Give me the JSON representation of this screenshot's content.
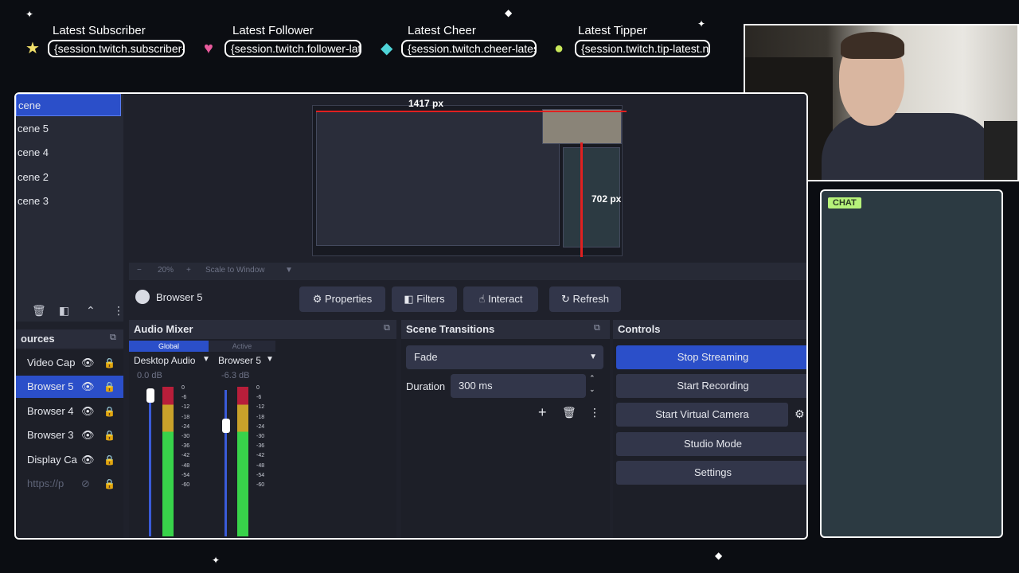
{
  "alerts": [
    {
      "title": "Latest Subscriber",
      "value": "{session.twitch.subscriber-latest.name}",
      "icon": "star-icon",
      "icon_color": "#f2e06a"
    },
    {
      "title": "Latest Follower",
      "value": "{session.twitch.follower-latest.name}",
      "icon": "heart-icon",
      "icon_color": "#e85a9c"
    },
    {
      "title": "Latest Cheer",
      "value": "{session.twitch.cheer-latest.name}",
      "icon": "gem-icon",
      "icon_color": "#4fd4d8"
    },
    {
      "title": "Latest Tipper",
      "value": "{session.twitch.tip-latest.name}",
      "icon": "coin-icon",
      "icon_color": "#c9e85a"
    }
  ],
  "chat": {
    "label": "CHAT"
  },
  "scenes": [
    {
      "label": "cene",
      "active": true
    },
    {
      "label": "cene 5",
      "active": false
    },
    {
      "label": "cene 4",
      "active": false
    },
    {
      "label": "cene 2",
      "active": false
    },
    {
      "label": "cene 3",
      "active": false
    }
  ],
  "preview": {
    "width_label": "1417 px",
    "height_label": "702 px"
  },
  "zoombar": {
    "minus": "−",
    "zoom": "20%",
    "plus": "+",
    "scale": "Scale to Window"
  },
  "source_toolbar": {
    "source_name": "Browser 5",
    "properties": "Properties",
    "filters": "Filters",
    "interact": "Interact",
    "refresh": "Refresh"
  },
  "sources": {
    "title": "ources",
    "items": [
      {
        "label": "Video Cap",
        "active": false,
        "disabled": false
      },
      {
        "label": "Browser 5",
        "active": true,
        "disabled": false
      },
      {
        "label": "Browser 4",
        "active": false,
        "disabled": false
      },
      {
        "label": "Browser 3",
        "active": false,
        "disabled": false
      },
      {
        "label": "Display Ca",
        "active": false,
        "disabled": false
      },
      {
        "label": "https://p",
        "active": false,
        "disabled": true
      }
    ]
  },
  "audio_mixer": {
    "title": "Audio Mixer",
    "tabs": [
      "Global",
      "Active"
    ],
    "channels": [
      {
        "name": "Desktop Audio",
        "db": "0.0 dB",
        "fader_level": 0.96
      },
      {
        "name": "Browser 5",
        "db": "-6.3 dB",
        "fader_level": 0.8
      }
    ],
    "ticks": [
      "0",
      "-6",
      "-12",
      "-18",
      "-24",
      "-30",
      "-36",
      "-42",
      "-48",
      "-54",
      "-60"
    ]
  },
  "scene_transitions": {
    "title": "Scene Transitions",
    "transition": "Fade",
    "duration_label": "Duration",
    "duration_value": "300 ms"
  },
  "controls": {
    "title": "Controls",
    "buttons": [
      "Stop Streaming",
      "Start Recording",
      "Start Virtual Camera",
      "Studio Mode",
      "Settings"
    ]
  }
}
